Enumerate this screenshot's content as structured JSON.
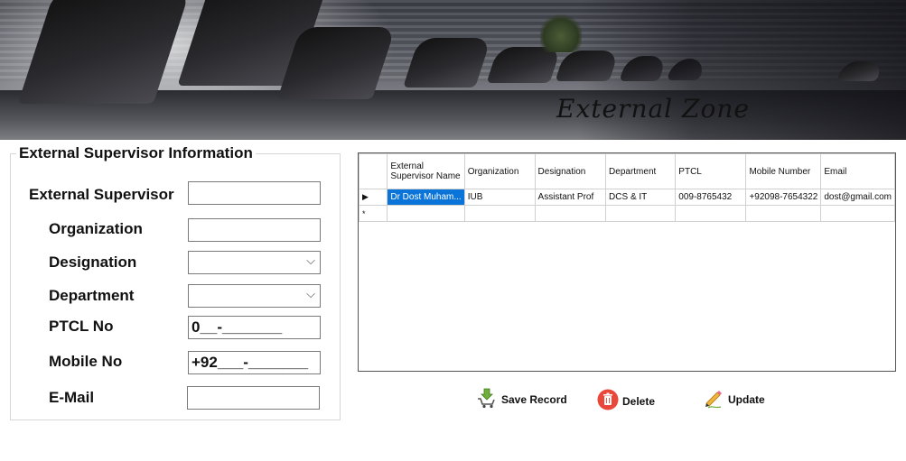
{
  "banner": {
    "title": "External Zone"
  },
  "form": {
    "title": "External Supervisor Information",
    "labels": {
      "supervisor": "External Supervisor",
      "organization": "Organization",
      "designation": "Designation",
      "department": "Department",
      "ptcl": "PTCL No",
      "mobile": "Mobile No",
      "email": "E-Mail"
    },
    "values": {
      "supervisor": "",
      "organization": "",
      "designation": "",
      "department": "",
      "ptcl": "0__-_______",
      "mobile": "+92___-_______",
      "email": ""
    }
  },
  "grid": {
    "columns": [
      "External Supervisor Name",
      "Organization",
      "Designation",
      "Department",
      "PTCL",
      "Mobile Number",
      "Email"
    ],
    "rows": [
      [
        "Dr Dost Muham...",
        "IUB",
        "Assistant Prof",
        "DCS & IT",
        "009-8765432",
        "+92098-7654322",
        "dost@gmail.com"
      ]
    ],
    "current_row_marker": "▶",
    "new_row_marker": "*"
  },
  "buttons": {
    "save": "Save Record",
    "delete": "Delete",
    "update": "Update"
  },
  "colors": {
    "selection": "#0a74d8",
    "delete_icon": "#e8473a",
    "save_icon": "#6fae3a",
    "update_icon": "#f0b43a"
  }
}
